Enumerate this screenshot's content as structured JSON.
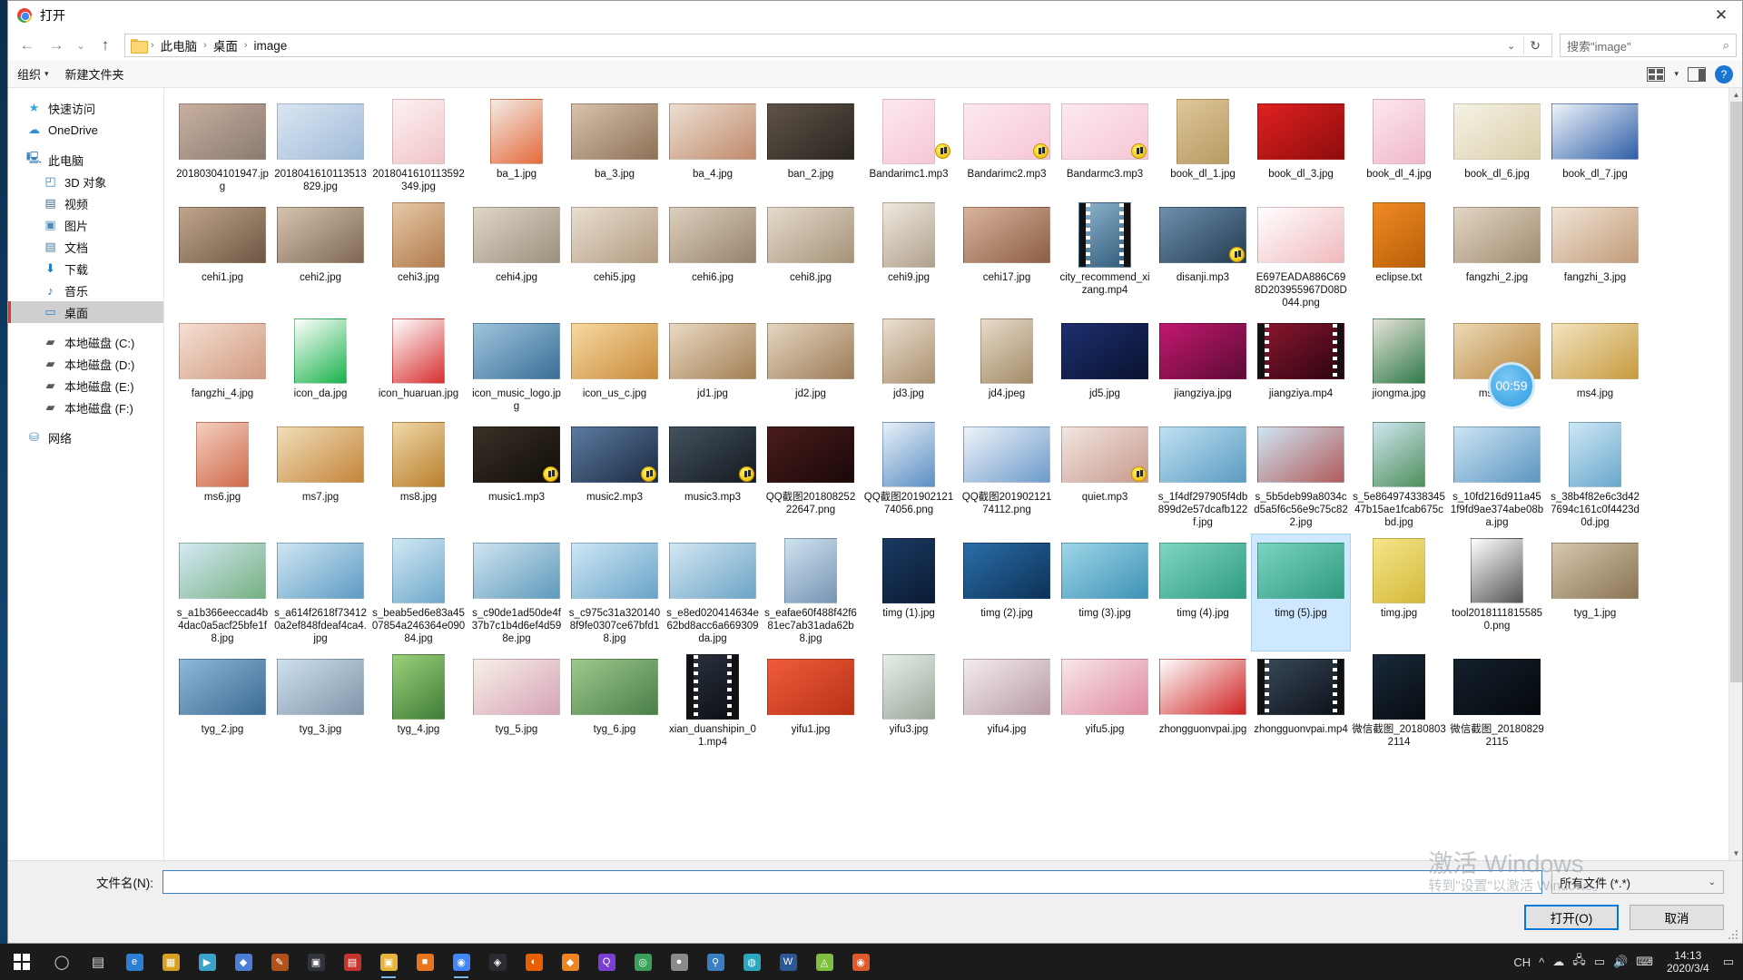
{
  "window": {
    "title": "打开",
    "app_icon": "chrome-icon",
    "close_label": "✕"
  },
  "nav": {
    "back": "←",
    "forward": "→",
    "history": "⌄",
    "up": "↑",
    "breadcrumb": [
      "此电脑",
      "桌面",
      "image"
    ],
    "breadcrumb_caret": "⌄",
    "refresh": "↻"
  },
  "search": {
    "text": "搜索\"image\"",
    "icon": "search-icon"
  },
  "toolbar": {
    "organize": "组织",
    "organize_caret": "▾",
    "new_folder": "新建文件夹",
    "view_icon": "view-layout-icon",
    "view_caret": "▾",
    "pane_icon": "preview-pane-icon",
    "help": "?"
  },
  "sidebar": {
    "items": [
      {
        "label": "快速访问",
        "icon": "star-icon",
        "indent": false,
        "selected": false
      },
      {
        "label": "OneDrive",
        "icon": "cloud-icon",
        "indent": false,
        "selected": false
      },
      {
        "label": "此电脑",
        "icon": "monitor-icon",
        "indent": false,
        "selected": false
      },
      {
        "label": "3D 对象",
        "icon": "cube-icon",
        "indent": true,
        "selected": false
      },
      {
        "label": "视频",
        "icon": "video-icon",
        "indent": true,
        "selected": false
      },
      {
        "label": "图片",
        "icon": "picture-icon",
        "indent": true,
        "selected": false
      },
      {
        "label": "文档",
        "icon": "document-icon",
        "indent": true,
        "selected": false
      },
      {
        "label": "下载",
        "icon": "download-icon",
        "indent": true,
        "selected": false
      },
      {
        "label": "音乐",
        "icon": "music-note-icon",
        "indent": true,
        "selected": false
      },
      {
        "label": "桌面",
        "icon": "desktop-icon",
        "indent": true,
        "selected": true
      },
      {
        "label": "本地磁盘 (C:)",
        "icon": "disk-system-icon",
        "indent": true,
        "selected": false
      },
      {
        "label": "本地磁盘 (D:)",
        "icon": "disk-icon",
        "indent": true,
        "selected": false
      },
      {
        "label": "本地磁盘 (E:)",
        "icon": "disk-icon",
        "indent": true,
        "selected": false
      },
      {
        "label": "本地磁盘 (F:)",
        "icon": "disk-icon",
        "indent": true,
        "selected": false
      },
      {
        "label": "网络",
        "icon": "network-icon",
        "indent": false,
        "selected": false
      }
    ]
  },
  "files": [
    {
      "name": "20180304101947.jpg",
      "kind": "image",
      "c1": "#c8b0a0",
      "c2": "#8a7b70",
      "sel": false
    },
    {
      "name": "2018041610113513829.jpg",
      "kind": "image",
      "c1": "#dbe6f2",
      "c2": "#9fbbd8",
      "sel": false
    },
    {
      "name": "2018041610113592349.jpg",
      "kind": "image",
      "c1": "#fdf2f2",
      "c2": "#f0c3c8",
      "sel": false
    },
    {
      "name": "ba_1.jpg",
      "kind": "image",
      "c1": "#f2ece6",
      "c2": "#e46a3c",
      "sel": false
    },
    {
      "name": "ba_3.jpg",
      "kind": "image",
      "c1": "#d7c2ab",
      "c2": "#8d7158",
      "sel": false
    },
    {
      "name": "ba_4.jpg",
      "kind": "image",
      "c1": "#ecdfd2",
      "c2": "#c08a6c",
      "sel": false
    },
    {
      "name": "ban_2.jpg",
      "kind": "image",
      "c1": "#5e5348",
      "c2": "#2c2620",
      "sel": false
    },
    {
      "name": "Bandarimc1.mp3",
      "kind": "mp3",
      "c1": "#fde9ef",
      "c2": "#f6c6d6",
      "sel": false
    },
    {
      "name": "Bandarimc2.mp3",
      "kind": "mp3",
      "c1": "#fde9ef",
      "c2": "#f6c6d6",
      "sel": false
    },
    {
      "name": "Bandarmc3.mp3",
      "kind": "mp3",
      "c1": "#fde9ef",
      "c2": "#f6c6d6",
      "sel": false
    },
    {
      "name": "book_dl_1.jpg",
      "kind": "image",
      "c1": "#dec79a",
      "c2": "#b99a62",
      "sel": false
    },
    {
      "name": "book_dl_3.jpg",
      "kind": "image",
      "c1": "#e02020",
      "c2": "#8d0d0d",
      "sel": false
    },
    {
      "name": "book_dl_4.jpg",
      "kind": "image",
      "c1": "#fce7ee",
      "c2": "#f0b7cd",
      "sel": false
    },
    {
      "name": "book_dl_6.jpg",
      "kind": "image",
      "c1": "#f6f2e6",
      "c2": "#d9cfa9",
      "sel": false
    },
    {
      "name": "book_dl_7.jpg",
      "kind": "image",
      "c1": "#eef3fa",
      "c2": "#2f5fa8",
      "sel": false
    },
    {
      "name": "cehi1.jpg",
      "kind": "image",
      "c1": "#c0a58c",
      "c2": "#6d5743",
      "sel": false
    },
    {
      "name": "cehi2.jpg",
      "kind": "image",
      "c1": "#d6c3ae",
      "c2": "#7e6853",
      "sel": false
    },
    {
      "name": "cehi3.jpg",
      "kind": "image",
      "c1": "#e7c9a7",
      "c2": "#b07a4c",
      "sel": false
    },
    {
      "name": "cehi4.jpg",
      "kind": "image",
      "c1": "#dfd6c8",
      "c2": "#9c8f7d",
      "sel": false
    },
    {
      "name": "cehi5.jpg",
      "kind": "image",
      "c1": "#e9ded0",
      "c2": "#b29b80",
      "sel": false
    },
    {
      "name": "cehi6.jpg",
      "kind": "image",
      "c1": "#ddd0be",
      "c2": "#96826c",
      "sel": false
    },
    {
      "name": "cehi8.jpg",
      "kind": "image",
      "c1": "#e5dacc",
      "c2": "#a59378",
      "sel": false
    },
    {
      "name": "cehi9.jpg",
      "kind": "image",
      "c1": "#efe8df",
      "c2": "#b0a18d",
      "sel": false
    },
    {
      "name": "cehi17.jpg",
      "kind": "image",
      "c1": "#d9b49b",
      "c2": "#8b5e45",
      "sel": false
    },
    {
      "name": "city_recommend_xizang.mp4",
      "kind": "mp4",
      "c1": "#8fb4cf",
      "c2": "#2f5a78",
      "sel": false
    },
    {
      "name": "disanji.mp3",
      "kind": "mp3",
      "c1": "#6d8fae",
      "c2": "#253c52",
      "sel": false
    },
    {
      "name": "E697EADA886C698D203955967D08D044.png",
      "kind": "image",
      "c1": "#ffffff",
      "c2": "#f0b9bd",
      "sel": false
    },
    {
      "name": "eclipse.txt",
      "kind": "app",
      "c1": "#f08a24",
      "c2": "#b85f08",
      "sel": false
    },
    {
      "name": "fangzhi_2.jpg",
      "kind": "image",
      "c1": "#e3d6c5",
      "c2": "#a08b6f",
      "sel": false
    },
    {
      "name": "fangzhi_3.jpg",
      "kind": "image",
      "c1": "#f0e4d6",
      "c2": "#c29b78",
      "sel": false
    },
    {
      "name": "fangzhi_4.jpg",
      "kind": "image",
      "c1": "#f5dfd2",
      "c2": "#d09a80",
      "sel": false
    },
    {
      "name": "icon_da.jpg",
      "kind": "image",
      "c1": "#ffffff",
      "c2": "#19b24a",
      "sel": false
    },
    {
      "name": "icon_huaruan.jpg",
      "kind": "image",
      "c1": "#ffffff",
      "c2": "#d62f2f",
      "sel": false
    },
    {
      "name": "icon_music_logo.jpg",
      "kind": "image",
      "c1": "#9fc4dd",
      "c2": "#3a6f96",
      "sel": false
    },
    {
      "name": "icon_us_c.jpg",
      "kind": "image",
      "c1": "#f6d9a0",
      "c2": "#c98b3c",
      "sel": false
    },
    {
      "name": "jd1.jpg",
      "kind": "image",
      "c1": "#e9d9c2",
      "c2": "#a37f55",
      "sel": false
    },
    {
      "name": "jd2.jpg",
      "kind": "image",
      "c1": "#e5d5c0",
      "c2": "#9c7c57",
      "sel": false
    },
    {
      "name": "jd3.jpg",
      "kind": "image",
      "c1": "#eadfd0",
      "c2": "#ab9070",
      "sel": false
    },
    {
      "name": "jd4.jpeg",
      "kind": "image",
      "c1": "#e7dbc9",
      "c2": "#a38b68",
      "sel": false
    },
    {
      "name": "jd5.jpg",
      "kind": "image",
      "c1": "#1d2f6e",
      "c2": "#0a1230",
      "sel": false
    },
    {
      "name": "jiangziya.jpg",
      "kind": "image",
      "c1": "#c2186f",
      "c2": "#5b0b35",
      "sel": false
    },
    {
      "name": "jiangziya.mp4",
      "kind": "mp4",
      "c1": "#8e1730",
      "c2": "#2a0410",
      "sel": false
    },
    {
      "name": "jiongma.jpg",
      "kind": "image",
      "c1": "#e7e3d8",
      "c2": "#2f7a4a",
      "sel": false
    },
    {
      "name": "ms1.jpg",
      "kind": "image",
      "c1": "#ecd9b6",
      "c2": "#b8863f",
      "sel": false
    },
    {
      "name": "ms4.jpg",
      "kind": "image",
      "c1": "#f2e3c0",
      "c2": "#c79b3e",
      "sel": false
    },
    {
      "name": "ms6.jpg",
      "kind": "image",
      "c1": "#f3cfc0",
      "c2": "#cf6a4a",
      "sel": false
    },
    {
      "name": "ms7.jpg",
      "kind": "image",
      "c1": "#f0ddb8",
      "c2": "#c4853a",
      "sel": false
    },
    {
      "name": "ms8.jpg",
      "kind": "image",
      "c1": "#eed8a8",
      "c2": "#b97f2c",
      "sel": false
    },
    {
      "name": "music1.mp3",
      "kind": "mp3",
      "c1": "#3a3027",
      "c2": "#110d09",
      "sel": false
    },
    {
      "name": "music2.mp3",
      "kind": "mp3",
      "c1": "#5c7aa0",
      "c2": "#1b2b42",
      "sel": false
    },
    {
      "name": "music3.mp3",
      "kind": "mp3",
      "c1": "#44525e",
      "c2": "#141a20",
      "sel": false
    },
    {
      "name": "QQ截图20180825222647.png",
      "kind": "image",
      "c1": "#4a1c1c",
      "c2": "#1a0808",
      "sel": false
    },
    {
      "name": "QQ截图20190212174056.png",
      "kind": "image",
      "c1": "#e8f0f8",
      "c2": "#5b8fc4",
      "sel": false
    },
    {
      "name": "QQ截图20190212174112.png",
      "kind": "image",
      "c1": "#eef3f9",
      "c2": "#6d9bcb",
      "sel": false
    },
    {
      "name": "quiet.mp3",
      "kind": "mp3",
      "c1": "#f2e5e0",
      "c2": "#c79a8d",
      "sel": false
    },
    {
      "name": "s_1f4df297905f4db899d2e57dcafb122f.jpg",
      "kind": "image",
      "c1": "#bfe0f2",
      "c2": "#5b9cc2",
      "sel": false
    },
    {
      "name": "s_5b5deb99a8034cd5a5f6c56e9c75c822.jpg",
      "kind": "image",
      "c1": "#cfe5f3",
      "c2": "#b05b5b",
      "sel": false
    },
    {
      "name": "s_5e86497433834547b15ae1fcab675cbd.jpg",
      "kind": "image",
      "c1": "#cfe6f0",
      "c2": "#4f8f5c",
      "sel": false
    },
    {
      "name": "s_10fd216d911a451f9fd9ae374abe08ba.jpg",
      "kind": "image",
      "c1": "#cbe4f4",
      "c2": "#5d96c0",
      "sel": false
    },
    {
      "name": "s_38b4f82e6c3d427694c161c0f4423d0d.jpg",
      "kind": "image",
      "c1": "#cde7f5",
      "c2": "#6aa8cc",
      "sel": false
    },
    {
      "name": "s_a1b366eeccad4b4dac0a5acf25bfe1f8.jpg",
      "kind": "image",
      "c1": "#d4e9f6",
      "c2": "#75b07f",
      "sel": false
    },
    {
      "name": "s_a614f2618f734120a2ef848fdeaf4ca4.jpg",
      "kind": "image",
      "c1": "#cfe6f2",
      "c2": "#5e9bc4",
      "sel": false
    },
    {
      "name": "s_beab5ed6e83a4507854a246364e09084.jpg",
      "kind": "image",
      "c1": "#d2e8f4",
      "c2": "#6fa9cb",
      "sel": false
    },
    {
      "name": "s_c90de1ad50de4f37b7c1b4d6ef4d598e.jpg",
      "kind": "image",
      "c1": "#cfe4f0",
      "c2": "#5f9abb",
      "sel": false
    },
    {
      "name": "s_c975c31a3201408f9fe0307ce67bfd18.jpg",
      "kind": "image",
      "c1": "#cde7f6",
      "c2": "#6ba4c8",
      "sel": false
    },
    {
      "name": "s_e8ed020414634e62bd8acc6a669309da.jpg",
      "kind": "image",
      "c1": "#d2e7f3",
      "c2": "#6da4c6",
      "sel": false
    },
    {
      "name": "s_eafae60f488f42f681ec7ab31ada62b8.jpg",
      "kind": "image",
      "c1": "#cfe3f0",
      "c2": "#7794b4",
      "sel": false
    },
    {
      "name": "timg (1).jpg",
      "kind": "image",
      "c1": "#1b3a63",
      "c2": "#0a1b33",
      "sel": false
    },
    {
      "name": "timg (2).jpg",
      "kind": "image",
      "c1": "#2a6ea8",
      "c2": "#0d3157",
      "sel": false
    },
    {
      "name": "timg (3).jpg",
      "kind": "image",
      "c1": "#9fd6e8",
      "c2": "#3d92b6",
      "sel": false
    },
    {
      "name": "timg (4).jpg",
      "kind": "image",
      "c1": "#7fd6c0",
      "c2": "#2f9c80",
      "sel": false
    },
    {
      "name": "timg (5).jpg",
      "kind": "image",
      "c1": "#7ad4bf",
      "c2": "#2f9a80",
      "sel": true
    },
    {
      "name": "timg.jpg",
      "kind": "image",
      "c1": "#f5e58a",
      "c2": "#d4b93a",
      "sel": false
    },
    {
      "name": "tool20181118155850.png",
      "kind": "image",
      "c1": "#ffffff",
      "c2": "#555555",
      "sel": false
    },
    {
      "name": "tyg_1.jpg",
      "kind": "image",
      "c1": "#d6c7ae",
      "c2": "#8a7454",
      "sel": false
    },
    {
      "name": "tyg_2.jpg",
      "kind": "image",
      "c1": "#8fb8d9",
      "c2": "#3d6b92",
      "sel": false
    },
    {
      "name": "tyg_3.jpg",
      "kind": "image",
      "c1": "#cfe0ef",
      "c2": "#7f95a8",
      "sel": false
    },
    {
      "name": "tyg_4.jpg",
      "kind": "image",
      "c1": "#9ad17a",
      "c2": "#3f7c37",
      "sel": false
    },
    {
      "name": "tyg_5.jpg",
      "kind": "image",
      "c1": "#f7f0e6",
      "c2": "#d6a3b8",
      "sel": false
    },
    {
      "name": "tyg_6.jpg",
      "kind": "image",
      "c1": "#9dc98d",
      "c2": "#4a7f48",
      "sel": false
    },
    {
      "name": "xian_duanshipin_01.mp4",
      "kind": "mp4",
      "c1": "#2b3340",
      "c2": "#0a0d12",
      "sel": false
    },
    {
      "name": "yifu1.jpg",
      "kind": "image",
      "c1": "#ef5c3a",
      "c2": "#b93216",
      "sel": false
    },
    {
      "name": "yifu3.jpg",
      "kind": "image",
      "c1": "#e6efe6",
      "c2": "#9ca79c",
      "sel": false
    },
    {
      "name": "yifu4.jpg",
      "kind": "image",
      "c1": "#f4ecef",
      "c2": "#b79aa6",
      "sel": false
    },
    {
      "name": "yifu5.jpg",
      "kind": "image",
      "c1": "#f7e7ea",
      "c2": "#e08aa0",
      "sel": false
    },
    {
      "name": "zhongguonvpai.jpg",
      "kind": "image",
      "c1": "#fdfdfd",
      "c2": "#d02222",
      "sel": false
    },
    {
      "name": "zhongguonvpai.mp4",
      "kind": "mp4",
      "c1": "#3a4a5a",
      "c2": "#0b1018",
      "sel": false
    },
    {
      "name": "微信截图_201808032114",
      "kind": "image",
      "c1": "#1a2a3a",
      "c2": "#070c12",
      "sel": false
    },
    {
      "name": "微信截图_201808292115",
      "kind": "image",
      "c1": "#14202c",
      "c2": "#05090d",
      "sel": false
    }
  ],
  "overlay": {
    "timer": "00:59",
    "timer_on_file": "ms1.jpg"
  },
  "bottom": {
    "filename_label": "文件名(N):",
    "filename_value": "",
    "filter": "所有文件 (*.*)",
    "filter_caret": "⌄",
    "open_button": "打开(O)",
    "cancel_button": "取消"
  },
  "watermark": {
    "line1": "激活 Windows",
    "line2": "转到\"设置\"以激活 Windows。"
  },
  "taskbar": {
    "start_icon": "windows-logo-icon",
    "items": [
      {
        "icon": "search-icon",
        "glyph": "◯"
      },
      {
        "icon": "task-view-icon",
        "glyph": "▤"
      },
      {
        "icon": "edge-icon",
        "glyph": "e",
        "color": "#2d7fd3"
      },
      {
        "icon": "store-icon",
        "glyph": "▦",
        "color": "#d8a020"
      },
      {
        "icon": "media-player-icon",
        "glyph": "▶",
        "color": "#3aa3c9"
      },
      {
        "icon": "network-tool-icon",
        "glyph": "◆",
        "color": "#4c7ed6"
      },
      {
        "icon": "editor-icon",
        "glyph": "✎",
        "color": "#b2521a"
      },
      {
        "icon": "terminal-icon",
        "glyph": "▣",
        "color": "#30343b"
      },
      {
        "icon": "pdf-icon",
        "glyph": "▤",
        "color": "#c4342c"
      },
      {
        "icon": "explorer-icon",
        "glyph": "▣",
        "color": "#e8b33a"
      },
      {
        "icon": "box-icon",
        "glyph": "■",
        "color": "#e8741e"
      },
      {
        "icon": "chrome-icon",
        "glyph": "◉",
        "color": "#4285f4"
      },
      {
        "icon": "idea-icon",
        "glyph": "◈",
        "color": "#2b2b33"
      },
      {
        "icon": "firefox-icon",
        "glyph": "◐",
        "color": "#e66000"
      },
      {
        "icon": "tool-orange-icon",
        "glyph": "◆",
        "color": "#f0841f"
      },
      {
        "icon": "q-icon",
        "glyph": "Q",
        "color": "#7b3fd4"
      },
      {
        "icon": "camera-icon",
        "glyph": "◎",
        "color": "#3aa05a"
      },
      {
        "icon": "user-icon",
        "glyph": "●",
        "color": "#8a8a8a"
      },
      {
        "icon": "pin-icon",
        "glyph": "⚲",
        "color": "#3a7fc4"
      },
      {
        "icon": "chat-icon",
        "glyph": "◍",
        "color": "#2aa8c0"
      },
      {
        "icon": "word-icon",
        "glyph": "W",
        "color": "#2b5797"
      },
      {
        "icon": "android-icon",
        "glyph": "◬",
        "color": "#7fbf3f"
      },
      {
        "icon": "power-icon",
        "glyph": "◉",
        "color": "#e0592a"
      }
    ],
    "tray": {
      "ime": "CH",
      "icons": [
        "^",
        "☁",
        "🖧",
        "▭",
        "🔊",
        "⌨"
      ],
      "time": "14:13",
      "date": "2020/3/4",
      "notify": "▭"
    }
  }
}
